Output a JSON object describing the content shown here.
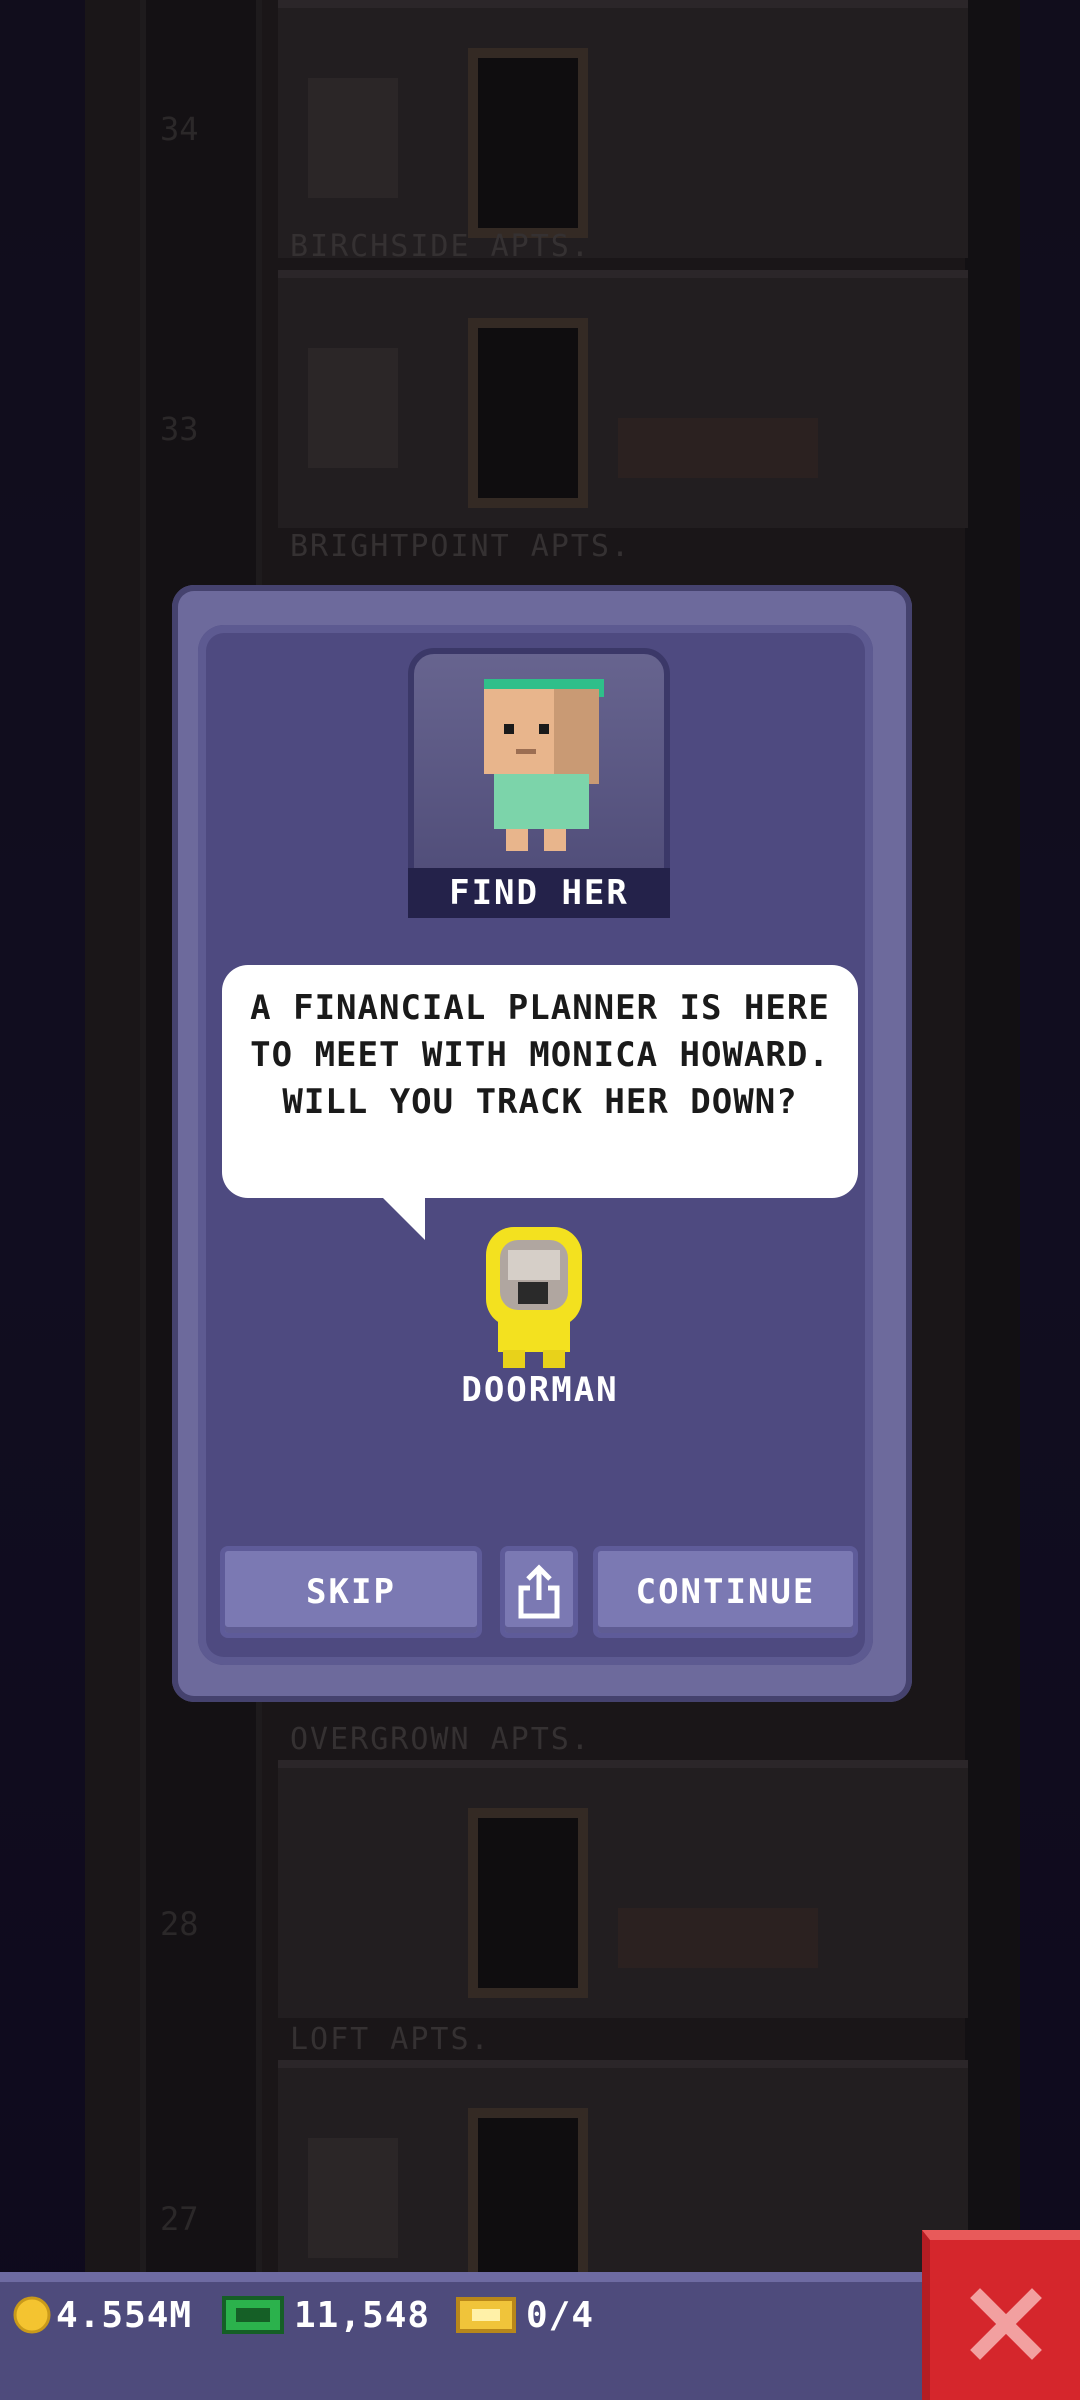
{
  "background": {
    "floors": [
      {
        "number": "34",
        "label": "BIRCHSIDE APTS."
      },
      {
        "number": "33",
        "label": "BRIGHTPOINT APTS."
      },
      {
        "number": "28",
        "label": "OVERGROWN APTS."
      },
      {
        "number": "27",
        "label": "LOFT APTS."
      }
    ]
  },
  "dialog": {
    "portrait_label": "FIND HER",
    "message": "A FINANCIAL PLANNER IS HERE TO MEET WITH MONICA HOWARD. WILL YOU TRACK HER DOWN?",
    "speaker": "DOORMAN",
    "buttons": {
      "skip": "SKIP",
      "continue": "CONTINUE"
    }
  },
  "status_bar": {
    "coins": "4.554M",
    "bux": "11,548",
    "tickets": "0/4"
  },
  "colors": {
    "dialog_bg": "#4e4a80",
    "button": "#7b79b3",
    "close_button": "#d5262c",
    "coin": "#f4c430",
    "bux": "#2bb24c"
  }
}
